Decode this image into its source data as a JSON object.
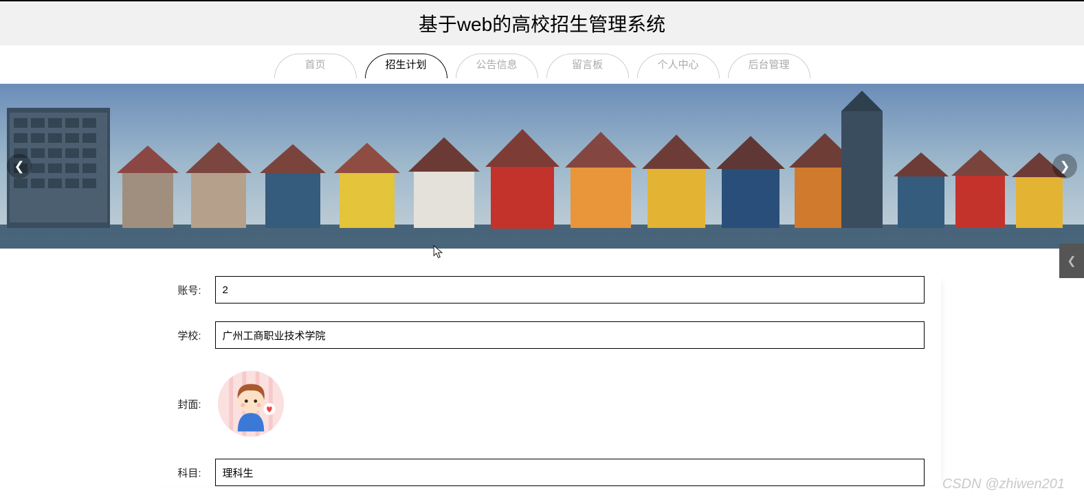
{
  "header": {
    "title": "基于web的高校招生管理系统"
  },
  "nav": {
    "items": [
      {
        "label": "首页",
        "active": false
      },
      {
        "label": "招生计划",
        "active": true
      },
      {
        "label": "公告信息",
        "active": false
      },
      {
        "label": "留言板",
        "active": false
      },
      {
        "label": "个人中心",
        "active": false
      },
      {
        "label": "后台管理",
        "active": false
      }
    ]
  },
  "form": {
    "account_label": "账号:",
    "account_value": "2",
    "school_label": "学校:",
    "school_value": "广州工商职业技术学院",
    "cover_label": "封面:",
    "subject_label": "科目:",
    "subject_value": "理科生"
  },
  "watermark": "CSDN @zhiwen201"
}
